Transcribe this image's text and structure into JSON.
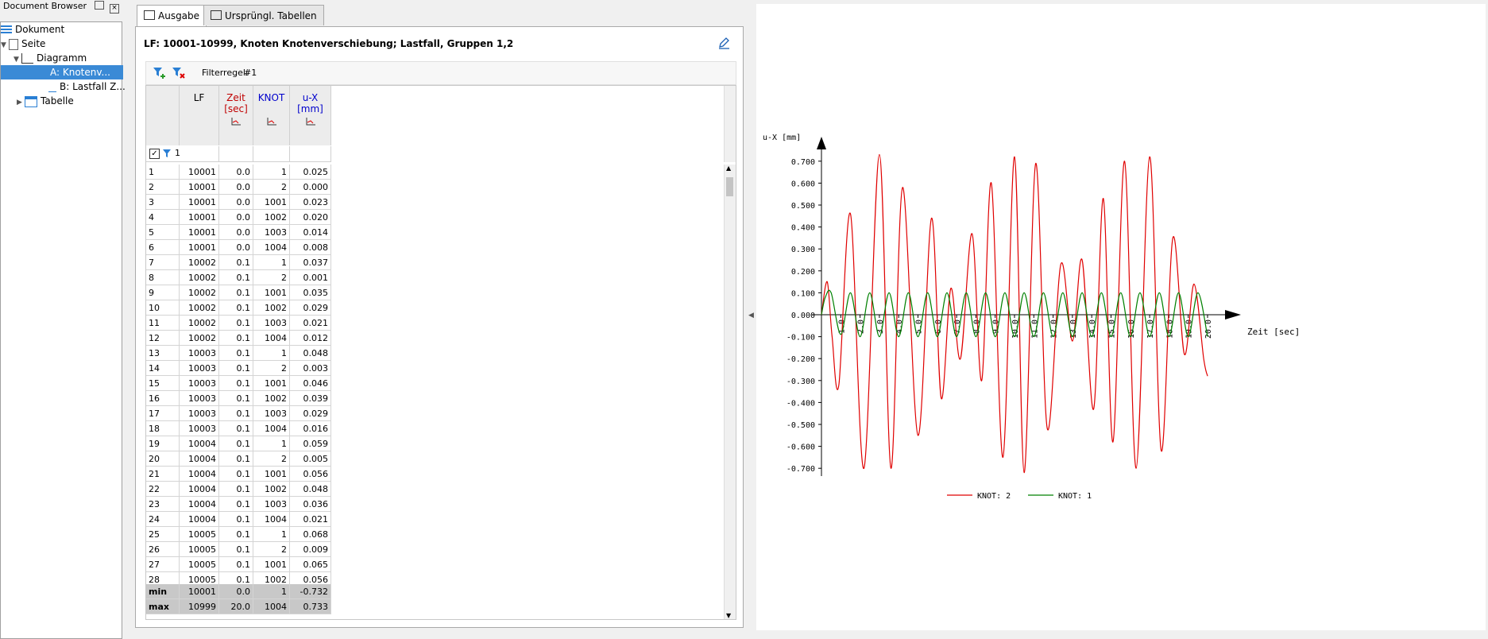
{
  "doc_browser": {
    "title": "Document Browser",
    "tree": [
      {
        "label": "Dokument",
        "icon": "document-list-icon"
      },
      {
        "label": "Seite",
        "icon": "page-icon"
      },
      {
        "label": "Diagramm",
        "icon": "diagram-icon"
      },
      {
        "label": "A: Knotenv...",
        "icon": "chart-series-icon",
        "selected": true
      },
      {
        "label": "B: Lastfall Z...",
        "icon": "chart-series-icon"
      },
      {
        "label": "Tabelle",
        "icon": "table-icon"
      }
    ]
  },
  "tabs": [
    {
      "label": "Ausgabe",
      "icon": "table-icon",
      "active": true
    },
    {
      "label": "Ursprüngl. Tabellen",
      "icon": "tables-icon",
      "active": false
    }
  ],
  "output": {
    "title": "LF: 10001-10999, Knoten Knotenverschiebung; Lastfall, Gruppen 1,2",
    "filter_label": "Filterregel:",
    "filter_value": "#1",
    "filter_row_value": "1",
    "columns": [
      {
        "label": "LF",
        "color": "#000000"
      },
      {
        "label": "Zeit\n[sec]",
        "color": "#c00000"
      },
      {
        "label": "KNOT",
        "color": "#0000cc"
      },
      {
        "label": "u-X\n[mm]",
        "color": "#0000cc"
      }
    ],
    "rows": [
      [
        "1",
        "10001",
        "0.0",
        "1",
        "0.025"
      ],
      [
        "2",
        "10001",
        "0.0",
        "2",
        "0.000"
      ],
      [
        "3",
        "10001",
        "0.0",
        "1001",
        "0.023"
      ],
      [
        "4",
        "10001",
        "0.0",
        "1002",
        "0.020"
      ],
      [
        "5",
        "10001",
        "0.0",
        "1003",
        "0.014"
      ],
      [
        "6",
        "10001",
        "0.0",
        "1004",
        "0.008"
      ],
      [
        "7",
        "10002",
        "0.1",
        "1",
        "0.037"
      ],
      [
        "8",
        "10002",
        "0.1",
        "2",
        "0.001"
      ],
      [
        "9",
        "10002",
        "0.1",
        "1001",
        "0.035"
      ],
      [
        "10",
        "10002",
        "0.1",
        "1002",
        "0.029"
      ],
      [
        "11",
        "10002",
        "0.1",
        "1003",
        "0.021"
      ],
      [
        "12",
        "10002",
        "0.1",
        "1004",
        "0.012"
      ],
      [
        "13",
        "10003",
        "0.1",
        "1",
        "0.048"
      ],
      [
        "14",
        "10003",
        "0.1",
        "2",
        "0.003"
      ],
      [
        "15",
        "10003",
        "0.1",
        "1001",
        "0.046"
      ],
      [
        "16",
        "10003",
        "0.1",
        "1002",
        "0.039"
      ],
      [
        "17",
        "10003",
        "0.1",
        "1003",
        "0.029"
      ],
      [
        "18",
        "10003",
        "0.1",
        "1004",
        "0.016"
      ],
      [
        "19",
        "10004",
        "0.1",
        "1",
        "0.059"
      ],
      [
        "20",
        "10004",
        "0.1",
        "2",
        "0.005"
      ],
      [
        "21",
        "10004",
        "0.1",
        "1001",
        "0.056"
      ],
      [
        "22",
        "10004",
        "0.1",
        "1002",
        "0.048"
      ],
      [
        "23",
        "10004",
        "0.1",
        "1003",
        "0.036"
      ],
      [
        "24",
        "10004",
        "0.1",
        "1004",
        "0.021"
      ],
      [
        "25",
        "10005",
        "0.1",
        "1",
        "0.068"
      ],
      [
        "26",
        "10005",
        "0.1",
        "2",
        "0.009"
      ],
      [
        "27",
        "10005",
        "0.1",
        "1001",
        "0.065"
      ],
      [
        "28",
        "10005",
        "0.1",
        "1002",
        "0.056"
      ]
    ],
    "summary": [
      [
        "min",
        "10001",
        "0.0",
        "1",
        "-0.732"
      ],
      [
        "max",
        "10999",
        "20.0",
        "1004",
        "0.733"
      ]
    ]
  },
  "chart_data": {
    "type": "line",
    "title": "",
    "xlabel": "Zeit [sec]",
    "ylabel": "u-X [mm]",
    "xlim": [
      0,
      20
    ],
    "ylim": [
      -0.75,
      0.75
    ],
    "xticks": [
      "1.0",
      "2.0",
      "3.0",
      "4.0",
      "5.0",
      "6.0",
      "7.0",
      "8.0",
      "9.0",
      "10.0",
      "11.0",
      "12.0",
      "13.0",
      "14.0",
      "15.0",
      "16.0",
      "17.0",
      "18.0",
      "19.0",
      "20.0"
    ],
    "yticks": [
      "0.700",
      "0.600",
      "0.500",
      "0.400",
      "0.300",
      "0.200",
      "0.100",
      "0.000",
      "-0.100",
      "-0.200",
      "-0.300",
      "-0.400",
      "-0.500",
      "-0.600",
      "-0.700"
    ],
    "ytick_values": [
      0.7,
      0.6,
      0.5,
      0.4,
      0.3,
      0.2,
      0.1,
      0.0,
      -0.1,
      -0.2,
      -0.3,
      -0.4,
      -0.5,
      -0.6,
      -0.7
    ],
    "legend_position": "bottom",
    "series": [
      {
        "name": "KNOT: 2",
        "color": "#e00000",
        "x": [
          0.0,
          0.3,
          0.55,
          0.9,
          1.5,
          2.2,
          3.0,
          3.6,
          4.2,
          5.0,
          5.7,
          6.2,
          6.7,
          7.2,
          7.8,
          8.3,
          8.8,
          9.4,
          10.0,
          10.5,
          11.1,
          11.7,
          12.4,
          13.0,
          13.5,
          14.1,
          14.6,
          15.1,
          15.7,
          16.3,
          17.0,
          17.6,
          18.2,
          18.8,
          19.3,
          19.8,
          20.0
        ],
        "y": [
          0.0,
          0.15,
          -0.1,
          -0.32,
          0.46,
          -0.7,
          0.73,
          -0.7,
          0.58,
          -0.55,
          0.44,
          -0.38,
          0.12,
          -0.2,
          0.37,
          -0.3,
          0.6,
          -0.65,
          0.72,
          -0.72,
          0.69,
          -0.52,
          0.23,
          -0.12,
          0.25,
          -0.43,
          0.53,
          -0.58,
          0.7,
          -0.7,
          0.72,
          -0.62,
          0.35,
          -0.18,
          0.14,
          -0.2,
          -0.28
        ]
      },
      {
        "name": "KNOT: 1",
        "color": "#008000",
        "x": [
          0.0,
          0.2,
          0.5,
          1.0,
          1.5,
          2.0,
          2.5,
          3.0,
          3.5,
          4.0,
          4.5,
          5.0,
          5.5,
          6.0,
          6.5,
          7.0,
          7.5,
          8.0,
          8.5,
          9.0,
          9.5,
          10.0,
          10.5,
          11.0,
          11.5,
          12.0,
          12.5,
          13.0,
          13.5,
          14.0,
          14.5,
          15.0,
          15.5,
          16.0,
          16.5,
          17.0,
          17.5,
          18.0,
          18.5,
          19.0,
          19.5,
          20.0
        ],
        "y": [
          0.0,
          0.08,
          0.1,
          -0.09,
          0.1,
          -0.1,
          0.1,
          -0.1,
          0.1,
          -0.1,
          0.1,
          -0.1,
          0.1,
          -0.1,
          0.1,
          -0.1,
          0.1,
          -0.1,
          0.1,
          -0.1,
          0.1,
          -0.1,
          0.1,
          -0.1,
          0.1,
          -0.1,
          0.1,
          -0.1,
          0.1,
          -0.1,
          0.1,
          -0.1,
          0.1,
          -0.1,
          0.1,
          -0.1,
          0.1,
          -0.1,
          0.1,
          -0.1,
          0.1,
          -0.1
        ]
      }
    ]
  }
}
